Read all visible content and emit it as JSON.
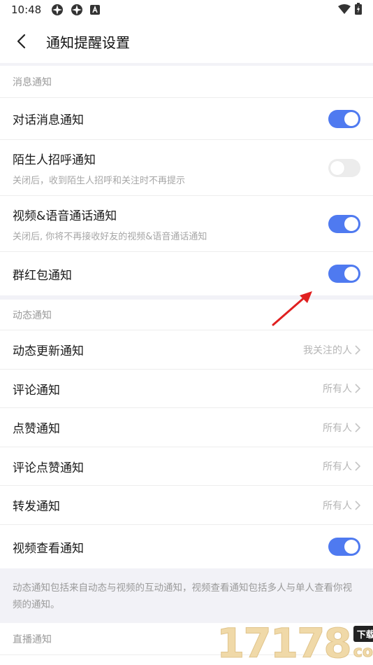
{
  "status_bar": {
    "time": "10:48"
  },
  "header": {
    "title": "通知提醒设置"
  },
  "sections": {
    "message": {
      "label": "消息通知"
    },
    "dynamic": {
      "label": "动态通知"
    },
    "live": {
      "label": "直播通知"
    }
  },
  "message_rows": [
    {
      "title": "对话消息通知",
      "toggle": "on"
    },
    {
      "title": "陌生人招呼通知",
      "subtitle": "关闭后，收到陌生人招呼和关注时不再提示",
      "toggle": "off"
    },
    {
      "title": "视频&语音通话通知",
      "subtitle": "关闭后, 你将不再接收好友的视频&语音通话通知",
      "toggle": "on"
    },
    {
      "title": "群红包通知",
      "toggle": "on"
    }
  ],
  "dynamic_rows": [
    {
      "title": "动态更新通知",
      "value": "我关注的人"
    },
    {
      "title": "评论通知",
      "value": "所有人"
    },
    {
      "title": "点赞通知",
      "value": "所有人"
    },
    {
      "title": "评论点赞通知",
      "value": "所有人"
    },
    {
      "title": "转发通知",
      "value": "所有人"
    },
    {
      "title": "视频查看通知",
      "toggle": "on"
    }
  ],
  "dynamic_note": "动态通知包括来自动态与视频的互动通知，视频查看通知包括多人与单人查看你视频的通知。",
  "watermark": {
    "digits": "17178",
    "badge": "下载站",
    "suffix": "com"
  },
  "colors": {
    "toggle_on": "#4f7af0",
    "toggle_off": "#ececec",
    "accent_arrow": "#e02020"
  }
}
